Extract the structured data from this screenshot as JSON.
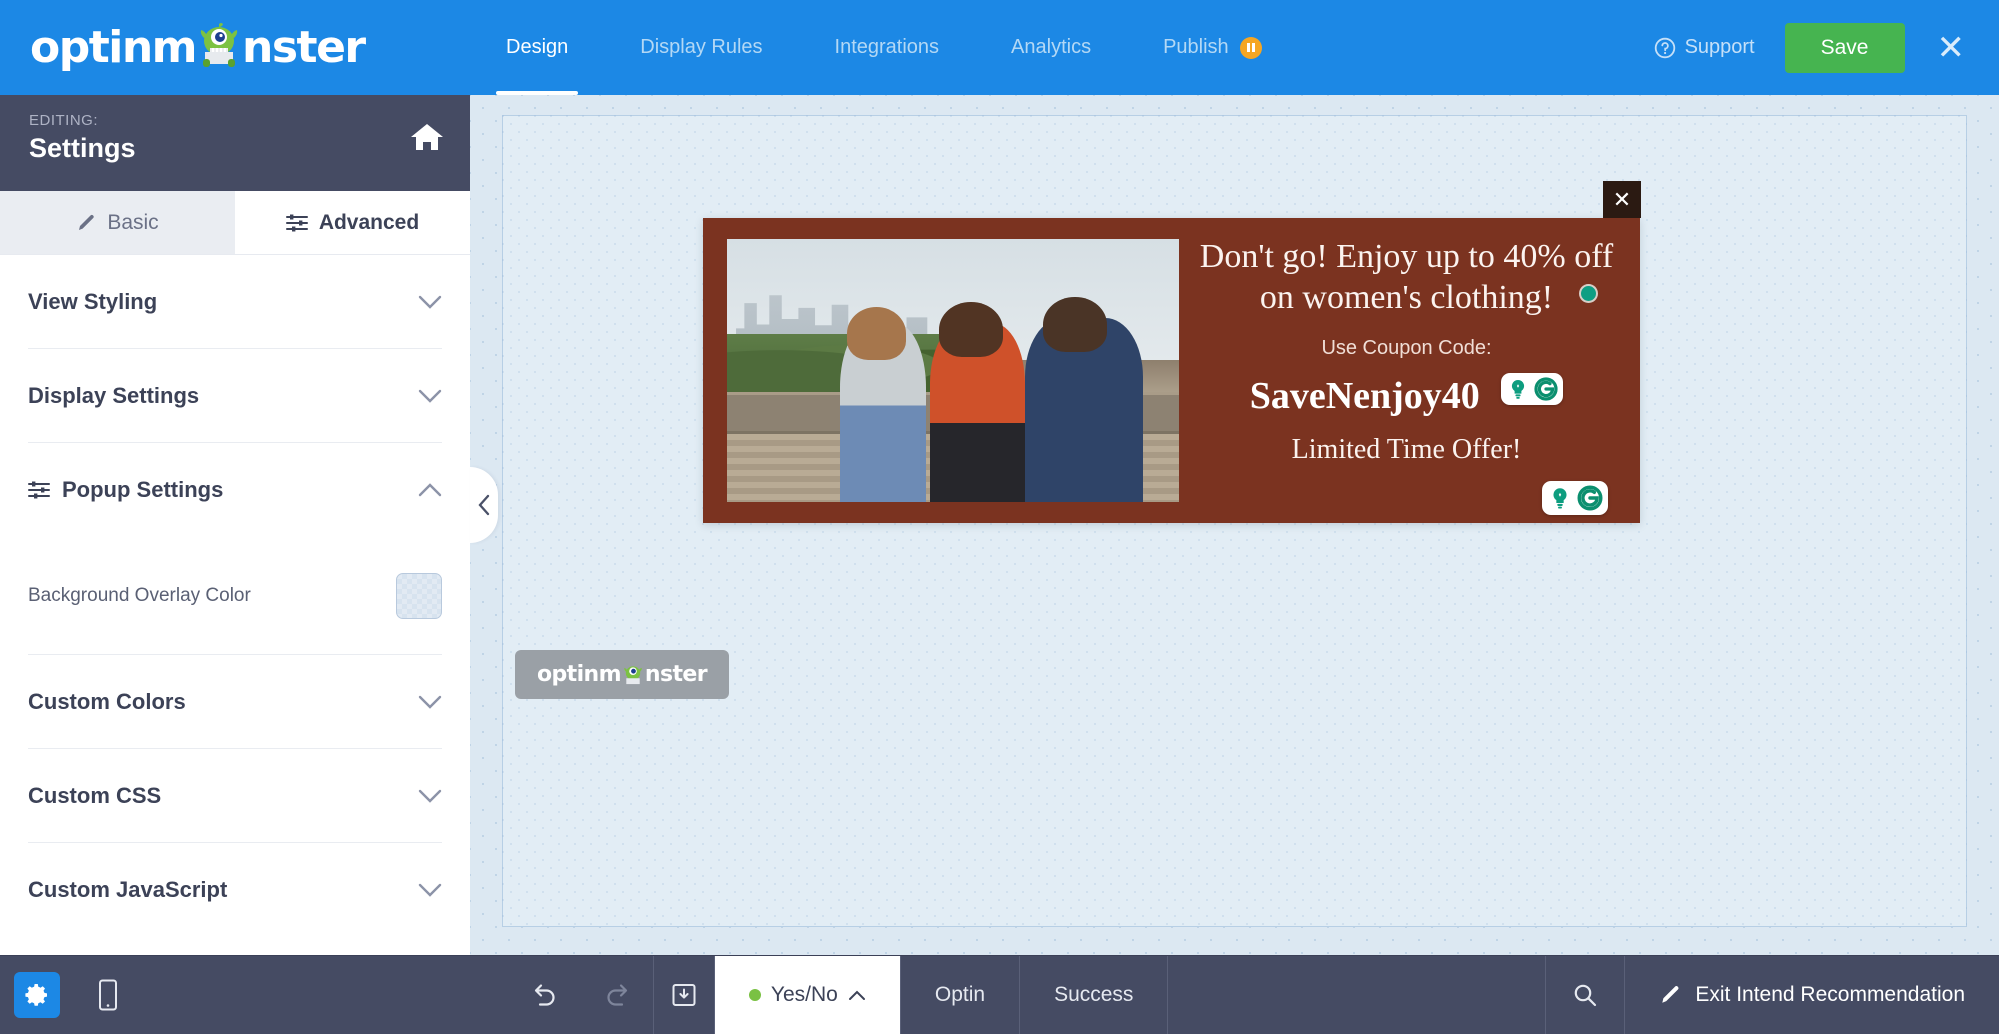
{
  "header": {
    "brand": "optinmonster",
    "brand_parts": {
      "pre": "optinm",
      "post": "nster"
    },
    "tabs": [
      {
        "label": "Design",
        "active": true
      },
      {
        "label": "Display Rules",
        "active": false
      },
      {
        "label": "Integrations",
        "active": false
      },
      {
        "label": "Analytics",
        "active": false
      },
      {
        "label": "Publish",
        "active": false,
        "badge": "paused"
      }
    ],
    "support_label": "Support",
    "save_label": "Save",
    "close_label": "✕",
    "accent_blue": "#1c88e5",
    "save_green": "#46b450",
    "badge_orange": "#f5a623"
  },
  "sidebar": {
    "editing_eyebrow": "EDITING:",
    "editing_title": "Settings",
    "home_icon": "home-icon",
    "segments": [
      {
        "label": "Basic",
        "icon": "pencil-icon",
        "active": false
      },
      {
        "label": "Advanced",
        "icon": "sliders-icon",
        "active": true
      }
    ],
    "sections": [
      {
        "label": "View Styling",
        "expanded": false,
        "icon": null
      },
      {
        "label": "Display Settings",
        "expanded": false,
        "icon": null
      },
      {
        "label": "Popup Settings",
        "expanded": true,
        "icon": "sliders-icon"
      },
      {
        "label": "Custom Colors",
        "expanded": false,
        "icon": null
      },
      {
        "label": "Custom CSS",
        "expanded": false,
        "icon": null
      },
      {
        "label": "Custom JavaScript",
        "expanded": false,
        "icon": null
      }
    ],
    "popup_settings": {
      "overlay_color_label": "Background Overlay Color",
      "overlay_color_value": "transparent"
    },
    "collapse_handle_icon": "chevron-left-icon",
    "head_bg": "#454b63"
  },
  "canvas": {
    "popup": {
      "close_label": "✕",
      "headline": "Don't go! Enjoy up to 40% off on women's clothing!",
      "subtext": "Use Coupon Code:",
      "coupon_code": "SaveNenjoy40",
      "note": "Limited Time Offer!",
      "background_color": "#7b3320",
      "image_alt": "three women laughing on a waterfront boardwalk",
      "grammarly_icon": "grammarly-icon",
      "suggestion_icon": "lightbulb-icon",
      "status_dot_color": "#0e9e83"
    },
    "om_badge": {
      "label": "optinmonster",
      "parts": {
        "pre": "optinm",
        "post": "nster"
      }
    }
  },
  "bottombar": {
    "gear_icon": "gear-icon",
    "mobile_icon": "mobile-icon",
    "undo_icon": "undo-icon",
    "redo_icon": "redo-icon",
    "save_template_icon": "save-template-icon",
    "views": [
      {
        "label": "Yes/No",
        "active": true,
        "dot": "#7ac143",
        "chevron": "chevron-up-icon"
      },
      {
        "label": "Optin",
        "active": false
      },
      {
        "label": "Success",
        "active": false
      }
    ],
    "search_icon": "search-icon",
    "exit_label": "Exit Intend Recommendation",
    "exit_icon": "pencil-icon"
  }
}
